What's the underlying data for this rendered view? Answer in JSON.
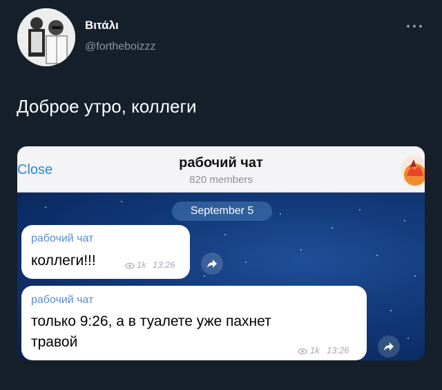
{
  "author": {
    "name": "Βιτάλι",
    "handle": "@fortheboizzz"
  },
  "icons": {
    "more": "more-horizontal-icon",
    "forward": "share-arrow-icon",
    "views": "eye-icon"
  },
  "tweet": {
    "text": "Доброе утро, коллеги"
  },
  "screenshot": {
    "close_label": "Close",
    "chat_title": "рабочий чат",
    "chat_subtitle": "820 members",
    "date_label": "September 5",
    "messages": [
      {
        "sender": "рабочий чат",
        "text": "коллеги!!!",
        "views": "1k",
        "time": "13:26"
      },
      {
        "sender": "рабочий чат",
        "text_line1": "только 9:26, а в туалете уже пахнет",
        "text_line2": "травой",
        "views": "1k",
        "time": "13:26"
      }
    ]
  },
  "colors": {
    "page_bg": "#15202b",
    "handle": "#8b98a5",
    "telegram_link": "#2b86d8",
    "sender_name": "#5a8bd0"
  }
}
